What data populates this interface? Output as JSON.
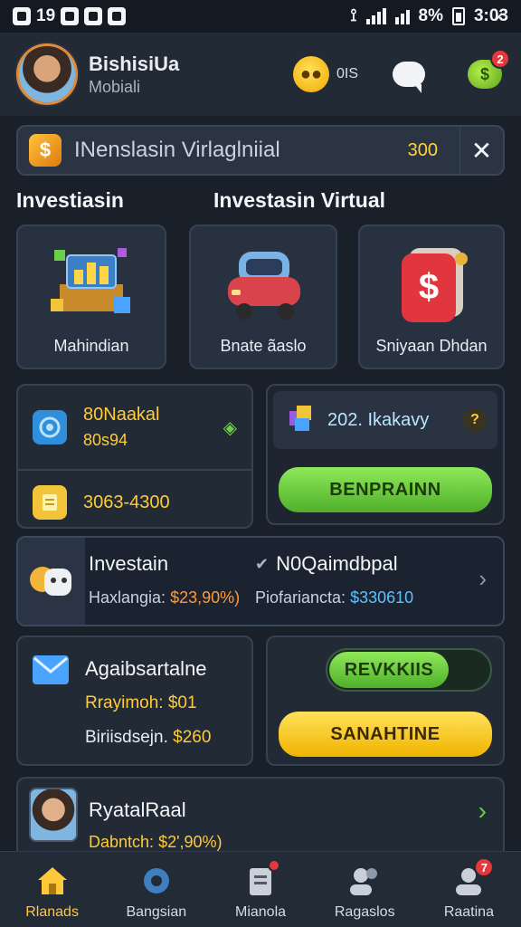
{
  "status_bar": {
    "left_text": "19",
    "battery": "8%",
    "time": "3:0̷3"
  },
  "header": {
    "user_name": "BishisiUa",
    "user_sub": "Mobiali",
    "count": "0IS",
    "chat_badge": "2"
  },
  "banner": {
    "icon_glyph": "$",
    "text": "INenslasin Virlaglniial",
    "value": "300",
    "close_glyph": "✕"
  },
  "sections": {
    "left_title": "Investiasin",
    "right_title": "Investasin Virtual"
  },
  "categories": [
    {
      "label": "Mahindian",
      "icon": "building-blocks-icon"
    },
    {
      "label": "Bnate ãaslo",
      "icon": "car-icon"
    },
    {
      "label": "Sniyaan Dhdan",
      "icon": "dollar-wallet-icon"
    }
  ],
  "stats_panel": {
    "row1_title": "80Naakal",
    "row1_value": "80s94",
    "row2_value": "3063-4300"
  },
  "reward_panel": {
    "title": "202. Ikakavy",
    "button": "BENPRAINN"
  },
  "investment_card": {
    "title": "Investain",
    "left_label": "Haxlangia:",
    "left_value": "$23,90%)",
    "right_title": "N0Qaimdbpal",
    "right_label": "Piofariancta:",
    "right_value": "$330610"
  },
  "message_panel": {
    "title": "Agaibsartalne",
    "line1_label": "Rrayimoh:",
    "line1_value": "$01",
    "line2_label": "Biriisdsejn.",
    "line2_value": "$260"
  },
  "actions_panel": {
    "outline_button": "REVKKIIS",
    "primary_button": "SANAHTINE"
  },
  "profile_card": {
    "title": "RyatalRaal",
    "label": "Dabntch:",
    "value": "$2',90%)"
  },
  "tabs": [
    {
      "label": "Rlanads",
      "icon": "home-icon",
      "active": true
    },
    {
      "label": "Bangsian",
      "icon": "gear-icon"
    },
    {
      "label": "Mianola",
      "icon": "document-icon",
      "badge": ""
    },
    {
      "label": "Ragaslos",
      "icon": "people-icon"
    },
    {
      "label": "Raatina",
      "icon": "profile-icon",
      "badge": "7"
    }
  ],
  "colors": {
    "background": "#1a202a",
    "accent_gold": "#ffcb3a",
    "green_button": "#6ed33a",
    "yellow_button": "#ffd033",
    "badge_red": "#e5383b"
  }
}
